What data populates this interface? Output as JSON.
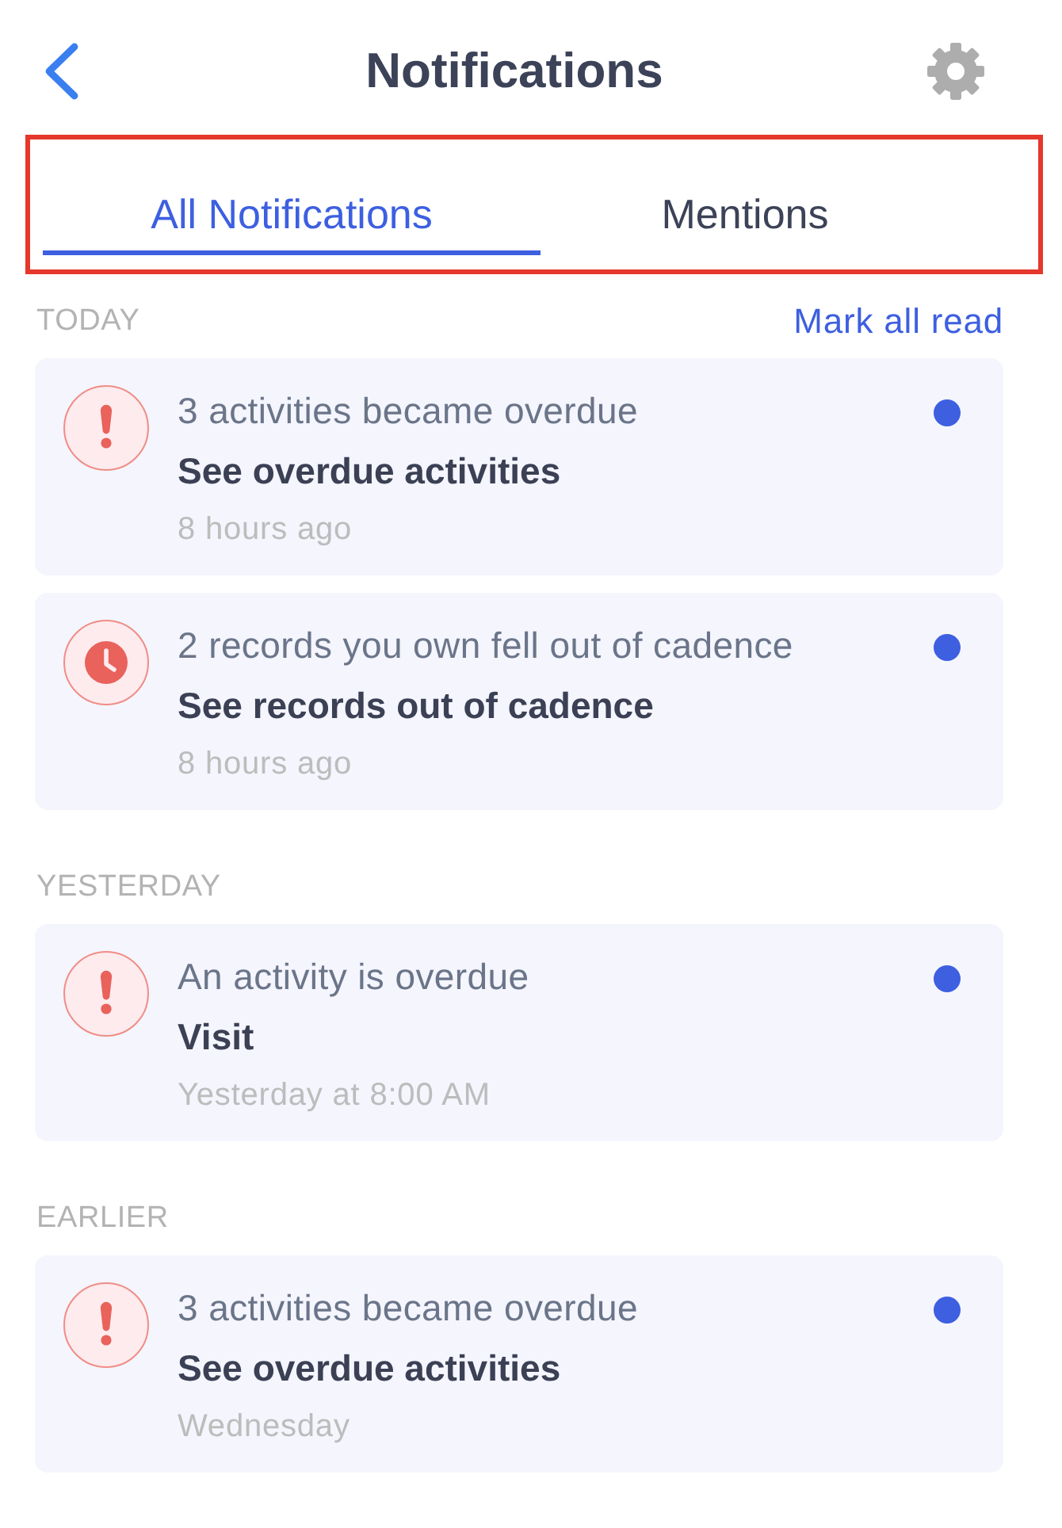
{
  "header": {
    "title": "Notifications"
  },
  "tabs_bar": {
    "highlighted": true,
    "tabs": [
      {
        "label": "All Notifications",
        "selected": true
      },
      {
        "label": "Mentions",
        "selected": false
      }
    ]
  },
  "sections": [
    {
      "heading": "TODAY",
      "action": "Mark all read",
      "notifications": [
        {
          "kind": "alert",
          "summary": "3 activities became overdue",
          "title": "See overdue activities",
          "time": "8 hours ago",
          "unread": true
        },
        {
          "kind": "clock",
          "summary": "2 records you own fell out of cadence",
          "title": "See records out of cadence",
          "time": "8 hours ago",
          "unread": true
        }
      ]
    },
    {
      "heading": "YESTERDAY",
      "notifications": [
        {
          "kind": "alert",
          "summary": "An activity is overdue",
          "title": "Visit",
          "time": "Yesterday at 8:00 AM",
          "unread": true
        }
      ]
    },
    {
      "heading": "EARLIER",
      "notifications": [
        {
          "kind": "alert",
          "summary": "3 activities became overdue",
          "title": "See overdue activities",
          "time": "Wednesday",
          "unread": true
        }
      ]
    }
  ]
}
